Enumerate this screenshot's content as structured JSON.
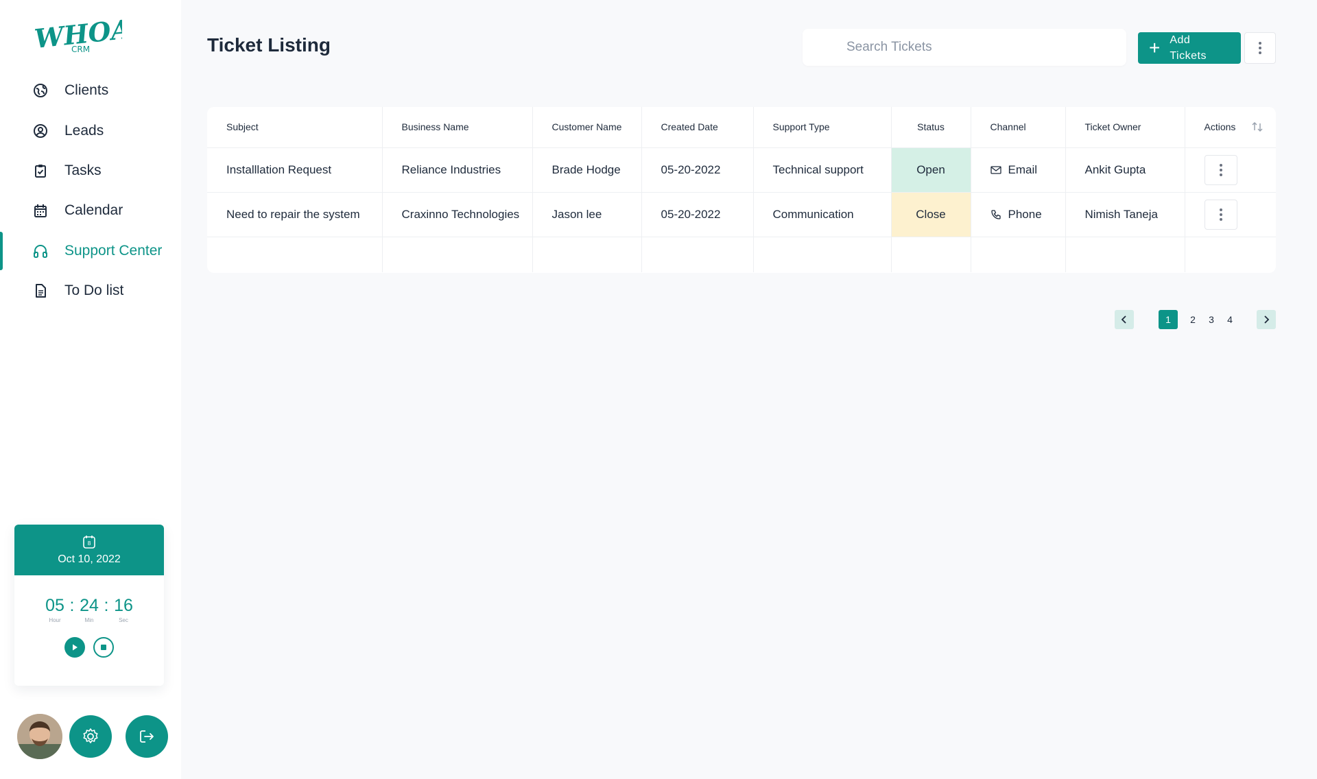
{
  "app": {
    "logo_text": "WHOA!",
    "logo_sub": "CRM"
  },
  "sidebar": {
    "items": [
      {
        "label": "Clients",
        "icon": "globe-icon",
        "active": false
      },
      {
        "label": "Leads",
        "icon": "user-circle-icon",
        "active": false
      },
      {
        "label": "Tasks",
        "icon": "clipboard-check-icon",
        "active": false
      },
      {
        "label": "Calendar",
        "icon": "calendar-icon",
        "active": false
      },
      {
        "label": "Support Center",
        "icon": "headphones-icon",
        "active": true
      },
      {
        "label": "To Do list",
        "icon": "document-icon",
        "active": false
      }
    ]
  },
  "timer": {
    "calendar_day": "8",
    "date": "Oct 10, 2022",
    "hours": "05",
    "minutes": "24",
    "seconds": "16",
    "hour_label": "Hour",
    "min_label": "Min",
    "sec_label": "Sec",
    "separator": ":"
  },
  "header": {
    "title": "Ticket Listing",
    "search_placeholder": "Search Tickets",
    "add_label_1": "Add",
    "add_label_2": "Tickets"
  },
  "table": {
    "columns": [
      "Subject",
      "Business Name",
      "Customer Name",
      "Created Date",
      "Support Type",
      "Status",
      "Channel",
      "Ticket Owner",
      "Actions"
    ],
    "rows": [
      {
        "subject": "Installlation Request",
        "business": "Reliance Industries",
        "customer": "Brade Hodge",
        "created": "05-20-2022",
        "support_type": "Technical support",
        "status": "Open",
        "channel": "Email",
        "owner": "Ankit Gupta"
      },
      {
        "subject": "Need to repair the system",
        "business": "Craxinno Technologies",
        "customer": "Jason lee",
        "created": "05-20-2022",
        "support_type": "Communication",
        "status": "Close",
        "channel": "Phone",
        "owner": "Nimish Taneja"
      }
    ]
  },
  "pagination": {
    "pages": [
      "1",
      "2",
      "3",
      "4"
    ],
    "current": "1"
  },
  "colors": {
    "accent": "#0d9488",
    "open_bg": "#d5f0e6",
    "close_bg": "#fdf1cf"
  }
}
